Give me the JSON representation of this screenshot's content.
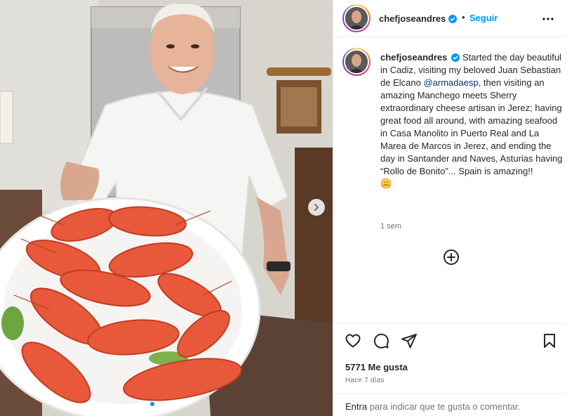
{
  "post": {
    "author": "chefjoseandres",
    "follow_label": "Seguir",
    "separator": "•",
    "caption_text": "Started the day beautiful in Cadiz, visiting my beloved Juan Sebastian de Elcano",
    "caption_mention": "@armadaesp",
    "caption_text_2": ", then visiting an amazing Manchego meets Sherry extraordinary cheese artisan in Jerez; having great food all around, with amazing seafood in Casa Manolito in Puerto Real and La Marea de Marcos in Jerez, and ending the day in Santander and Naves, Asturias having “Rollo de Bonito”... Spain is amazing!!",
    "caption_emoji": "hugging-face",
    "caption_time": "1 sem",
    "likes": "5771 Me gusta",
    "date": "Hace 7 días",
    "login_link": "Entra",
    "login_text": " para indicar que te gusta o comentar.",
    "carousel": {
      "total": 5,
      "current": 1
    }
  },
  "colors": {
    "accent": "#0095f6",
    "mention": "#00376b",
    "text": "#262626",
    "secondary": "#737373",
    "verified": "#0095f6"
  },
  "icons": {
    "header_more": "more-horizontal-icon",
    "load_comments": "plus-circle-icon",
    "like": "heart-icon",
    "comment": "comment-icon",
    "share": "share-icon",
    "save": "bookmark-icon",
    "next": "chevron-right-icon",
    "verified": "verified-badge-icon"
  }
}
